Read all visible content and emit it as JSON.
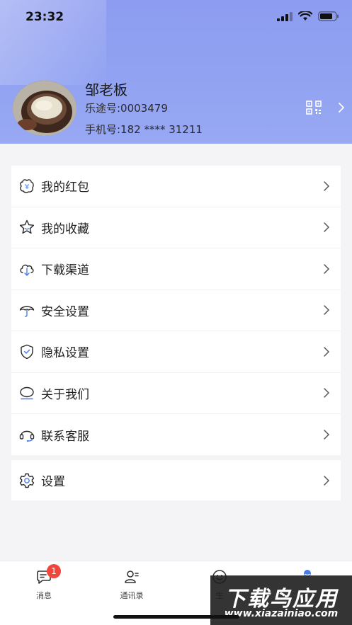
{
  "status_bar": {
    "time": "23:32"
  },
  "profile": {
    "name": "邹老板",
    "id_line": "乐途号:0003479",
    "phone_line": "手机号:182 **** 31211"
  },
  "menu": {
    "items": [
      {
        "label": "我的红包",
        "icon": "red-packet-icon"
      },
      {
        "label": "我的收藏",
        "icon": "star-icon"
      },
      {
        "label": "下载渠道",
        "icon": "cloud-download-icon"
      },
      {
        "label": "安全设置",
        "icon": "umbrella-icon"
      },
      {
        "label": "隐私设置",
        "icon": "shield-icon"
      },
      {
        "label": "关于我们",
        "icon": "chat-bubble-icon"
      },
      {
        "label": "联系客服",
        "icon": "headset-icon"
      }
    ],
    "settings": {
      "label": "设置",
      "icon": "gear-icon"
    }
  },
  "tabbar": {
    "tabs": [
      {
        "label": "消息",
        "badge": "1"
      },
      {
        "label": "通讯录"
      },
      {
        "label": "生"
      },
      {
        "label": ""
      }
    ]
  },
  "watermark": {
    "title": "下载鸟应用",
    "url": "www.xiazainiao.com"
  },
  "colors": {
    "header": "#92a3f2",
    "accent": "#4a7de8",
    "badge": "#f0463c"
  }
}
